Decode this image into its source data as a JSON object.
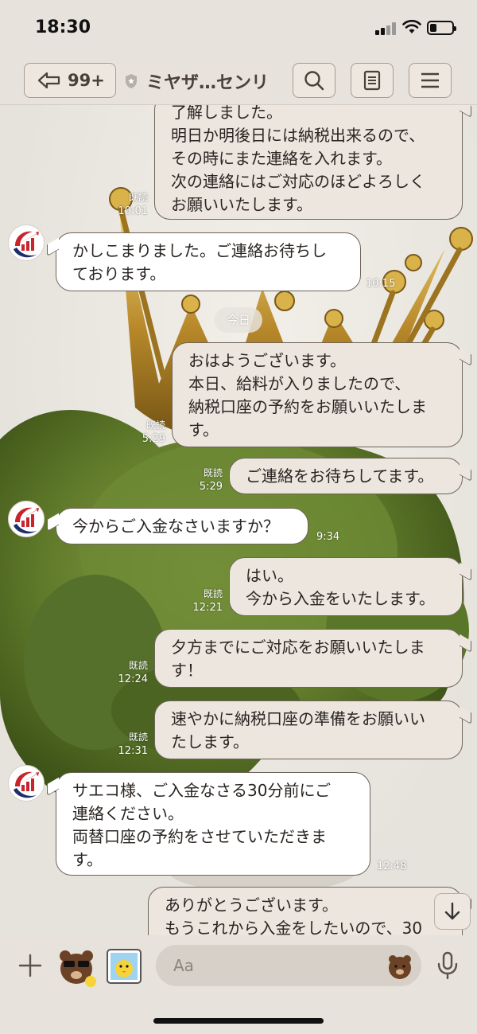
{
  "status_bar": {
    "time": "18:30"
  },
  "header": {
    "unread_count": "99+",
    "chat_title": "ミヤザ…センリ",
    "icons": [
      "back-arrow-icon",
      "shield-icon",
      "search-icon",
      "notes-icon",
      "menu-icon"
    ]
  },
  "messages": [
    {
      "side": "mine",
      "text": "了解しました。\n明日か明後日には納税出来るので、\nその時にまた連絡を入れます。\n次の連絡にはご対応のほどよろしく\nお願いいたします。",
      "read": "既読",
      "time": "10:01"
    },
    {
      "side": "theirs",
      "text": "かしこまりました。ご連絡お待ちし\nております。",
      "time": "10:15"
    },
    {
      "side": "mine",
      "text": "おはようございます。\n本日、給料が入りましたので、\n納税口座の予約をお願いいたしま\nす。",
      "read": "既読",
      "time": "5:29"
    },
    {
      "side": "mine",
      "text": "ご連絡をお待ちしてます。",
      "read": "既読",
      "time": "5:29"
    },
    {
      "side": "theirs",
      "text": "今からご入金なさいますか？",
      "time": "9:34"
    },
    {
      "side": "mine",
      "text": "はい。\n今から入金をいたします。",
      "read": "既読",
      "time": "12:21"
    },
    {
      "side": "mine",
      "text": "夕方までにご対応をお願いいたしま\nす！",
      "read": "既読",
      "time": "12:24"
    },
    {
      "side": "mine",
      "text": "速やかに納税口座の準備をお願いい\nたします。",
      "read": "既読",
      "time": "12:31"
    },
    {
      "side": "theirs",
      "text": "サエコ様、ご入金なさる30分前にご\n連絡ください。\n両替口座の予約をさせていただきま\nす。",
      "time": "12:48"
    },
    {
      "side": "mine",
      "text": "ありがとうございます。\nもうこれから入金をしたいので、30"
    }
  ],
  "date_separator": "今日",
  "input": {
    "placeholder": "Aa"
  },
  "colors": {
    "my_bubble": "#ece6df",
    "their_bubble": "#ffffff",
    "bar": "#e7e2dc",
    "border": "#6f6459"
  }
}
